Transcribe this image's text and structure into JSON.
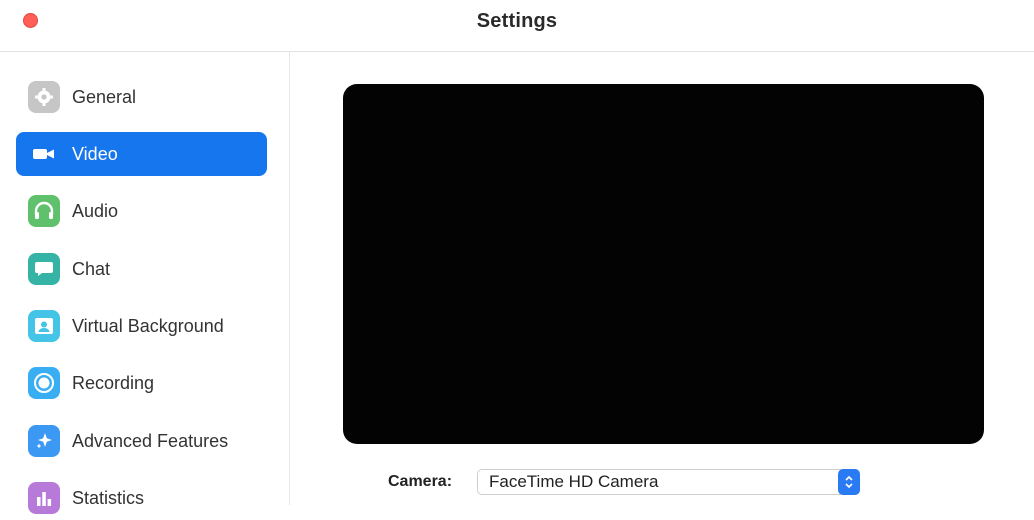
{
  "window": {
    "title": "Settings"
  },
  "sidebar": {
    "items": [
      {
        "label": "General",
        "icon": "gear-icon",
        "color": "#c6c6c6",
        "active": false
      },
      {
        "label": "Video",
        "icon": "video-camera-icon",
        "color": "#1676ee",
        "active": true
      },
      {
        "label": "Audio",
        "icon": "headphones-icon",
        "color": "#5fc16b",
        "active": false
      },
      {
        "label": "Chat",
        "icon": "chat-bubble-icon",
        "color": "#35b3a5",
        "active": false
      },
      {
        "label": "Virtual Background",
        "icon": "portrait-icon",
        "color": "#44c4e6",
        "active": false
      },
      {
        "label": "Recording",
        "icon": "record-icon",
        "color": "#3aaef2",
        "active": false
      },
      {
        "label": "Advanced Features",
        "icon": "sparkle-icon",
        "color": "#3b98f3",
        "active": false
      },
      {
        "label": "Statistics",
        "icon": "bar-chart-icon",
        "color": "#b77ad9",
        "active": false
      }
    ]
  },
  "main": {
    "camera_label": "Camera:",
    "camera_value": "FaceTime HD Camera"
  },
  "colors": {
    "accent": "#1676ee",
    "close": "#ff5f57",
    "preview": "#030303"
  }
}
